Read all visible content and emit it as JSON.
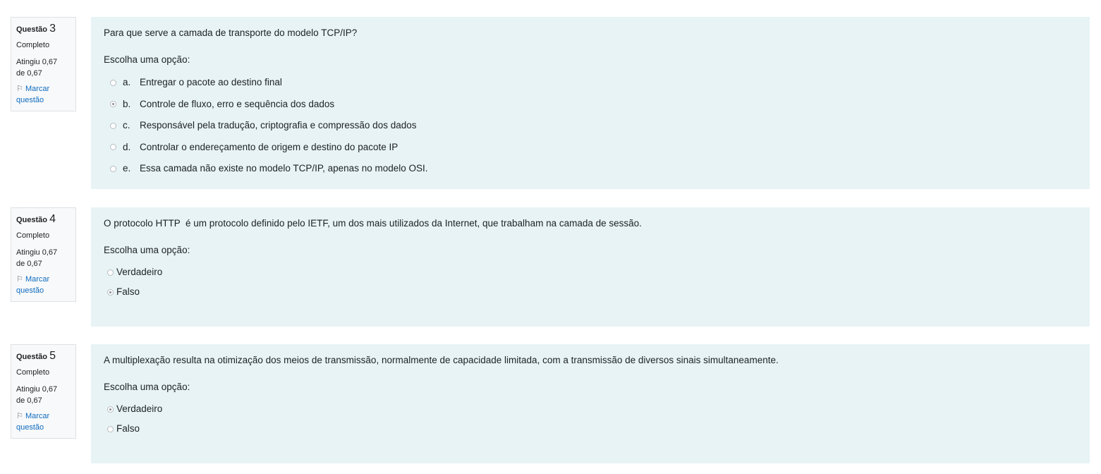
{
  "questions": [
    {
      "label": "Questão",
      "number": "3",
      "state": "Completo",
      "grade_line1": "Atingiu 0,67",
      "grade_line2": "de 0,67",
      "flag_line1": "Marcar",
      "flag_line2": "questão",
      "text": "Para que serve a camada de transporte do modelo TCP/IP?",
      "prompt": "Escolha uma opção:",
      "options": [
        {
          "letter": "a.",
          "text": "Entregar o pacote ao destino final",
          "selected": false
        },
        {
          "letter": "b.",
          "text": "Controle de fluxo, erro e sequência dos dados",
          "selected": true
        },
        {
          "letter": "c.",
          "text": "Responsável pela tradução, criptografia e compressão dos dados",
          "selected": false
        },
        {
          "letter": "d.",
          "text": "Controlar o endereçamento de origem e destino do pacote IP",
          "selected": false
        },
        {
          "letter": "e.",
          "text": "Essa camada não existe no modelo TCP/IP, apenas no modelo OSI.",
          "selected": false
        }
      ]
    },
    {
      "label": "Questão",
      "number": "4",
      "state": "Completo",
      "grade_line1": "Atingiu 0,67",
      "grade_line2": "de 0,67",
      "flag_line1": "Marcar",
      "flag_line2": "questão",
      "text": "O protocolo HTTP  é um protocolo definido pelo IETF, um dos mais utilizados da Internet, que trabalham na camada de sessão.",
      "prompt": "Escolha uma opção:",
      "options": [
        {
          "text": "Verdadeiro",
          "selected": false
        },
        {
          "text": "Falso",
          "selected": true
        }
      ]
    },
    {
      "label": "Questão",
      "number": "5",
      "state": "Completo",
      "grade_line1": "Atingiu 0,67",
      "grade_line2": "de 0,67",
      "flag_line1": "Marcar",
      "flag_line2": "questão",
      "text": "A multiplexação resulta na otimização dos meios de transmissão, normalmente de capacidade limitada, com a transmissão de diversos sinais simultaneamente.",
      "prompt": "Escolha uma opção:",
      "options": [
        {
          "text": "Verdadeiro",
          "selected": true
        },
        {
          "text": "Falso",
          "selected": false
        }
      ]
    }
  ],
  "icons": {
    "flag": "flag-icon",
    "radio": "radio-icon"
  },
  "colors": {
    "info_bg": "#f8f9fa",
    "content_bg": "#e7f3f5",
    "link": "#0f6cbf"
  }
}
